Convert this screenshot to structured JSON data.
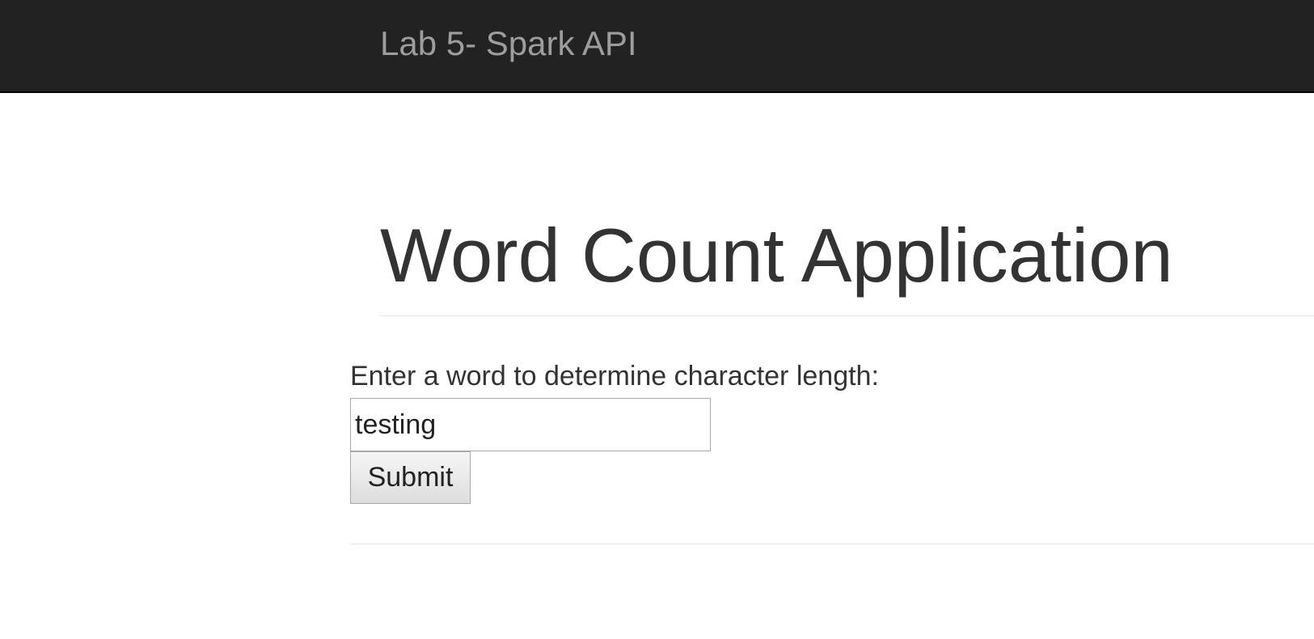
{
  "navbar": {
    "brand": "Lab 5- Spark API"
  },
  "header": {
    "title": "Word Count Application"
  },
  "form": {
    "label": "Enter a word to determine character length:",
    "input_value": "testing",
    "submit_label": "Submit"
  },
  "colors": {
    "navbar_bg": "#222222",
    "brand_text": "#9d9d9d",
    "body_text": "#333333",
    "rule": "#e5e5e5"
  }
}
